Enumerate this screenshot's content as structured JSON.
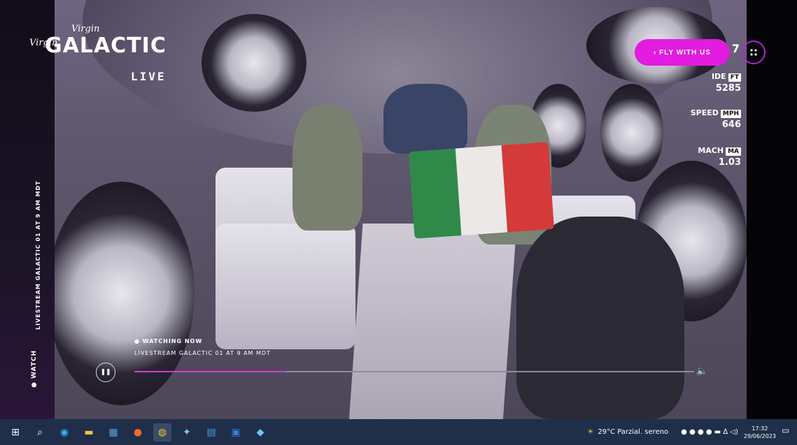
{
  "app": {
    "logo_script": "Virgin",
    "logo_title": "GALACTIC",
    "logo_live": "LIVE"
  },
  "header": {
    "fly_button_label": "› FLY WITH US",
    "menu_icon": "grid-dots-icon"
  },
  "telemetry": [
    {
      "label": "",
      "unit": "",
      "value": "7"
    },
    {
      "label": "IDE",
      "unit": "FT",
      "value": "5285"
    },
    {
      "label": "SPEED",
      "unit": "MPH",
      "value": "646"
    },
    {
      "label": "MACH",
      "unit": "MA",
      "value": "1.03"
    }
  ],
  "sidebar": {
    "vertical_title": "LIVESTREAM GALACTIC 01 AT 9 AM MDT",
    "watch_label": "● WATCH"
  },
  "player": {
    "watching_label": "● WATCHING NOW",
    "stream_title": "LIVESTREAM GALACTIC 01 AT 9 AM MDT",
    "progress": 0.27,
    "play_icon": "pause-icon",
    "volume_icon": "volume-icon"
  },
  "taskbar": {
    "icons": [
      "windows-start-icon",
      "search-icon",
      "edge-icon",
      "file-explorer-icon",
      "store-icon",
      "firefox-icon",
      "chrome-icon",
      "app-icon",
      "calendar-icon",
      "word-icon",
      "photos-icon"
    ],
    "weather": "29°C  Parzial. sereno",
    "time": "17:32",
    "date": "29/06/2023"
  },
  "colors": {
    "accent": "#e21ce0",
    "taskbar": "#1f2f4a"
  }
}
